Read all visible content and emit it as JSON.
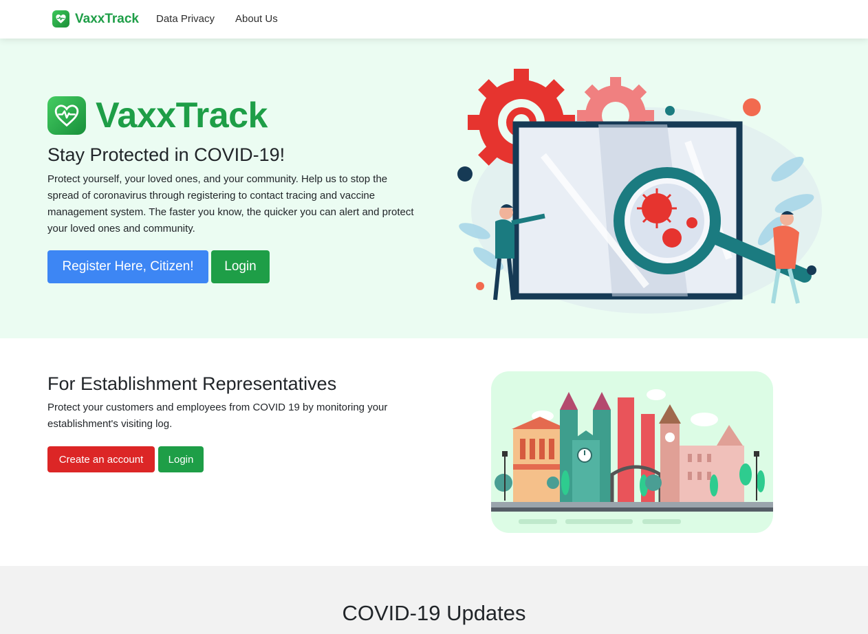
{
  "navbar": {
    "brand": "VaxxTrack",
    "links": [
      {
        "label": "Data Privacy"
      },
      {
        "label": "About Us"
      }
    ]
  },
  "hero": {
    "logo_text": "VaxxTrack",
    "title": "Stay Protected in COVID-19!",
    "description": "Protect yourself, your loved ones, and your community. Help us to stop the spread of coronavirus through registering to contact tracing and vaccine management system. The faster you know, the quicker you can alert and protect your loved ones and community.",
    "register_label": "Register Here, Citizen!",
    "login_label": "Login"
  },
  "establishment": {
    "title": "For Establishment Representatives",
    "description": "Protect your customers and employees from COVID 19 by monitoring your establishment's visiting log.",
    "create_label": "Create an account",
    "login_label": "Login"
  },
  "updates": {
    "title": "COVID-19 Updates"
  },
  "colors": {
    "brand_green": "#1e9e47",
    "primary_blue": "#3d86f4",
    "danger_red": "#dc2626",
    "hero_bg": "#ebfcf2",
    "updates_bg": "#f2f2f2"
  },
  "icons": {
    "brand": "heart-pulse-icon",
    "hero_illustration": "virus-magnifier-illustration",
    "city_illustration": "city-buildings-illustration"
  }
}
